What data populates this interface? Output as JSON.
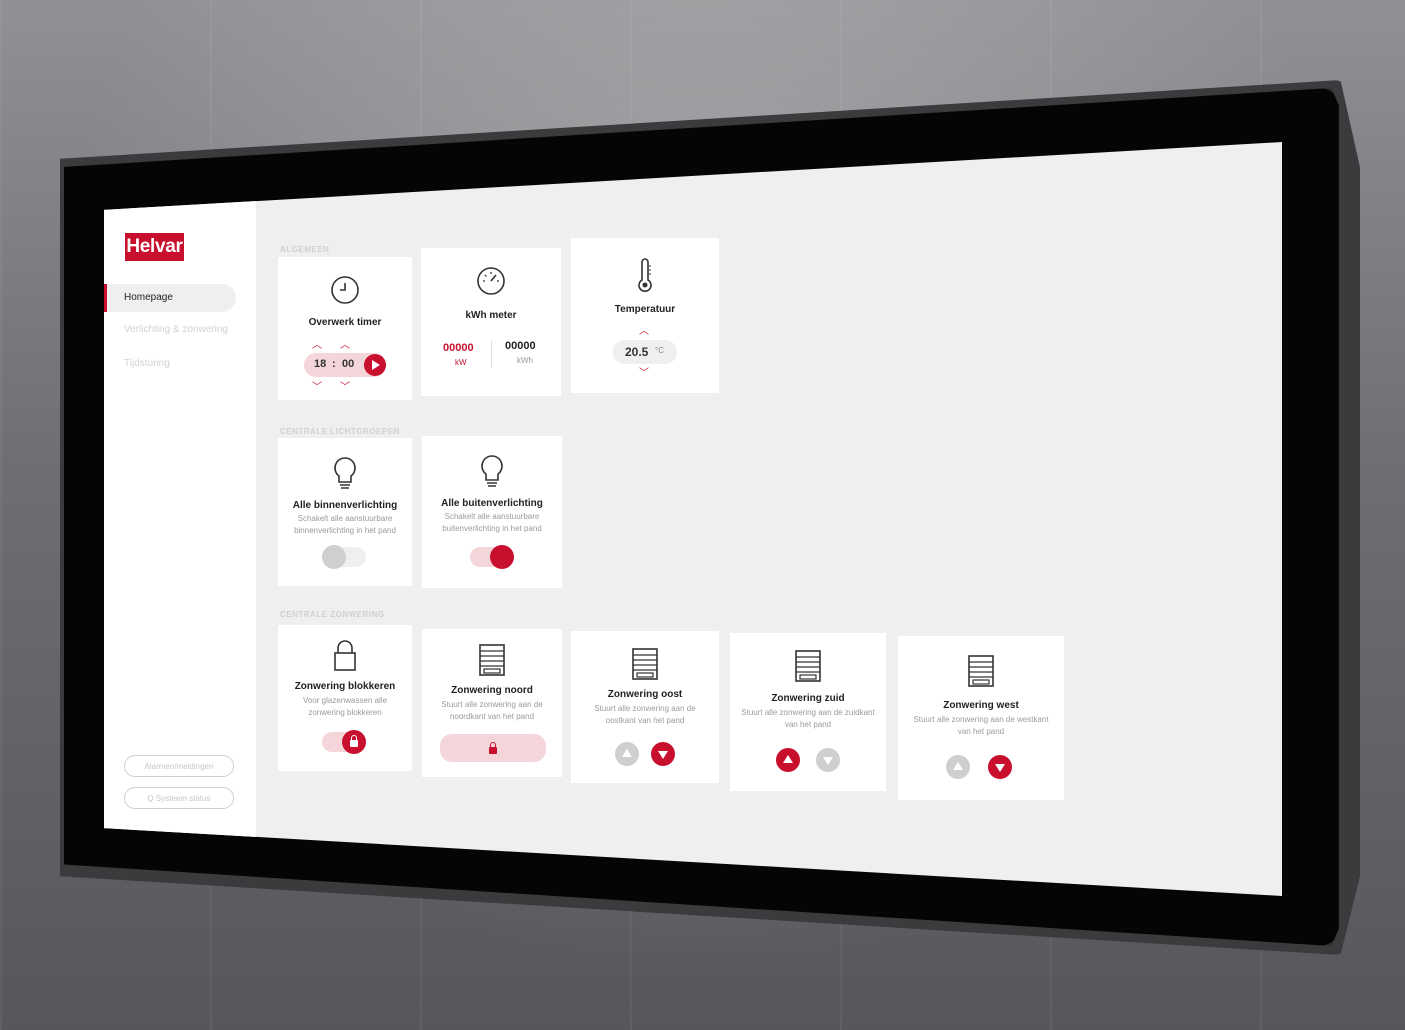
{
  "brand": {
    "name": "Helvar",
    "accent": "#c8102e"
  },
  "sidebar": {
    "items": [
      {
        "label": "Homepage",
        "active": true
      },
      {
        "label": "Verlichting & zonwering",
        "active": false
      },
      {
        "label": "Tijdsturing",
        "active": false
      }
    ],
    "buttons": [
      {
        "label": "Alarmen/meldingen",
        "icon": "alert-icon"
      },
      {
        "label": "Q  Systeem status",
        "icon": "search-icon"
      }
    ]
  },
  "sections": {
    "algemeen": "ALGEMEEN",
    "lichtgroepen": "CENTRALE LICHTGROEPEN",
    "zonwering": "CENTRALE ZONWERING"
  },
  "algemeen": {
    "timer": {
      "title": "Overwerk timer",
      "hours": "18",
      "separator": ":",
      "minutes": "00",
      "icon": "clock-icon"
    },
    "kwh": {
      "title": "kWh meter",
      "kw_value": "00000",
      "kw_unit": "kW",
      "kwh_value": "00000",
      "kwh_unit": "kWh",
      "icon": "gauge-icon"
    },
    "temp": {
      "title": "Temperatuur",
      "value": "20.5",
      "unit": "°C",
      "icon": "thermometer-icon"
    }
  },
  "lichtgroepen": [
    {
      "title": "Alle binnenverlichting",
      "desc": "Schakelt alle aanstuurbare binnenverlichting in het pand",
      "on": false,
      "icon": "lightbulb-icon"
    },
    {
      "title": "Alle buitenverlichting",
      "desc": "Schakelt alle aanstuurbare buitenverlichting in het pand",
      "on": true,
      "icon": "lightbulb-icon"
    }
  ],
  "zonwering": [
    {
      "title": "Zonwering blokkeren",
      "desc": "Voor glazenwassen alle zonwering blokkeren",
      "icon": "lock-icon"
    },
    {
      "title": "Zonwering noord",
      "desc": "Stuurt alle zonwering aan de noordkant van het pand",
      "icon": "blind-icon"
    },
    {
      "title": "Zonwering oost",
      "desc": "Stuurt alle zonwering aan de oostkant van het pand",
      "icon": "blind-icon"
    },
    {
      "title": "Zonwering zuid",
      "desc": "Stuurt alle zonwering aan de zuidkant van het pand",
      "icon": "blind-icon"
    },
    {
      "title": "Zonwering west",
      "desc": "Stuurt alle zonwering aan de westkant van het pand",
      "icon": "blind-icon"
    }
  ],
  "colors": {
    "active": "#c8102e",
    "inactive": "#cfcfcf",
    "pill": "#f4d6da"
  }
}
